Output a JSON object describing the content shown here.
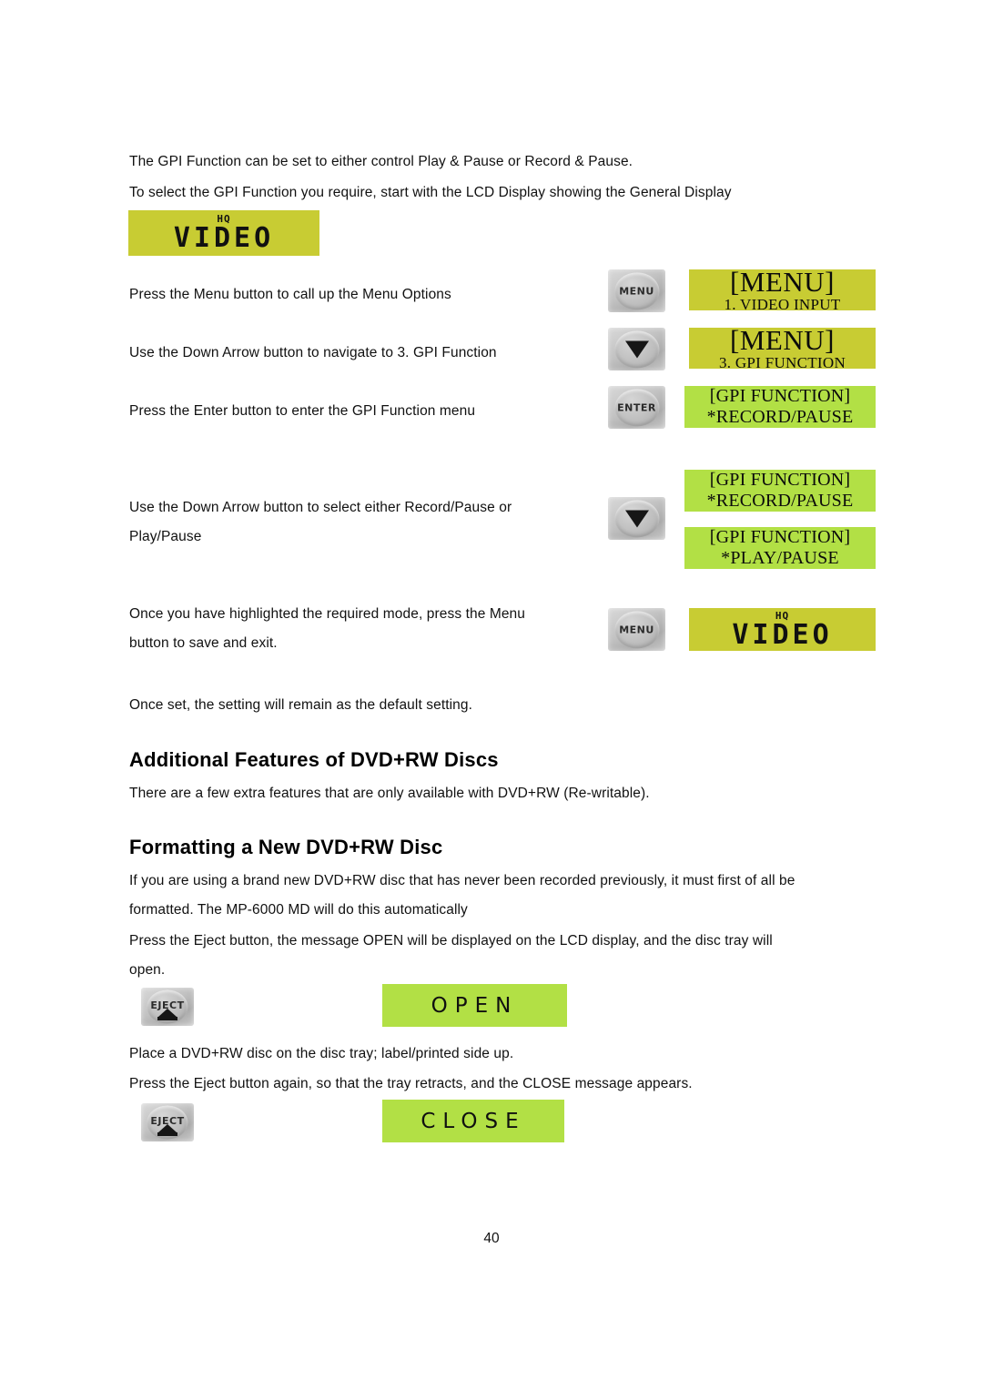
{
  "document": {
    "page_number": "40"
  },
  "paragraphs": {
    "intro_1": "The GPI Function can be set to either control Play & Pause or Record & Pause.",
    "intro_2": "To select the GPI Function you require, start with the LCD Display showing the General Display",
    "step_menu": "Press the Menu button to call up the Menu Options",
    "step_down": "Use the Down Arrow button to navigate to 3. GPI Function",
    "step_enter": "Press the Enter button to enter the GPI Function menu",
    "step_select": "Use the Down Arrow button to select either Record/Pause or\nPlay/Pause",
    "step_save": "Once you have highlighted the required mode, press the Menu\nbutton to save and exit.",
    "step_default": "Once set, the setting will remain as the default setting.",
    "additional_body": "There are a few extra features that are only available with DVD+RW (Re-writable).",
    "formatting_body_1": "If you are using a brand new DVD+RW disc that has never been recorded previously, it must first of all be\nformatted. The MP-6000 MD will do this automatically",
    "formatting_body_2": "Press the Eject button, the message OPEN will be displayed on the LCD display, and the disc tray will\nopen.",
    "place_disc": "Place a DVD+RW disc on the disc tray; label/printed side up.",
    "press_eject_again": "Press the Eject button again, so that the tray retracts, and the CLOSE message appears."
  },
  "headings": {
    "additional_features": "Additional Features of DVD+RW Discs",
    "formatting_new_disc": "Formatting a New DVD+RW Disc"
  },
  "buttons": {
    "menu": "MENU",
    "enter": "ENTER",
    "eject": "EJECT",
    "down_arrow": ""
  },
  "lcd": {
    "video_top": {
      "hq": "HQ",
      "text": "VIDEO",
      "color": "#c8cc33"
    },
    "video_bottom": {
      "hq": "HQ",
      "text": "VIDEO",
      "color": "#c8cc33"
    },
    "menu_video_input": {
      "line1": "[MENU]",
      "line2": "1. VIDEO INPUT",
      "color": "#c8cc33"
    },
    "menu_gpi_function": {
      "line1": "[MENU]",
      "line2": "3. GPI FUNCTION",
      "color": "#c8cc33"
    },
    "gpi_record_pause_1": {
      "line1": "[GPI FUNCTION]",
      "line2": "*RECORD/PAUSE",
      "color": "#b2e045"
    },
    "gpi_record_pause_2": {
      "line1": "[GPI FUNCTION]",
      "line2": "*RECORD/PAUSE",
      "color": "#b2e045"
    },
    "gpi_play_pause": {
      "line1": "[GPI FUNCTION]",
      "line2": "*PLAY/PAUSE",
      "color": "#b2e045"
    },
    "open": {
      "text": "OPEN",
      "color": "#b2e045"
    },
    "close": {
      "text": "CLOSE",
      "color": "#b2e045"
    }
  }
}
